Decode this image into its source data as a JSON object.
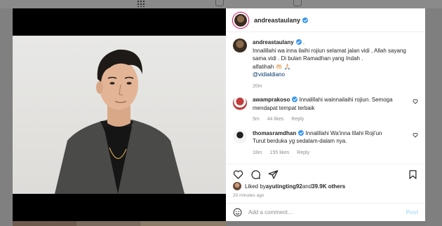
{
  "post": {
    "author": "andreastaulany",
    "menu_icon": "more-horizontal-icon"
  },
  "caption": {
    "username": "andreastaulany",
    "suffix": " .",
    "lines": [
      "Innalillahi wa inna ilaihi rojiun selamat jalan vidi , Allah sayang",
      "sama vidi . Di bulan Ramadhan yang Indah .",
      "alfatihah 🤲🏻 🙏🏻"
    ],
    "mention": "@vidialdiano",
    "time": "20m"
  },
  "comments": [
    {
      "username": "awamprakoso",
      "text_line1": " Innalillahi wainnailaihi rojiun. Semoga",
      "text_line2": "mendapat tempat terbaik",
      "time": "5m",
      "likes": "44 likes",
      "reply": "Reply"
    },
    {
      "username": "thomasramdhan",
      "text_line1": " Innalillahi Wa'inna Illahi Roji'un",
      "text_line2": "Turut berduka yg sedalam-dalam nya.",
      "time": "18m",
      "likes": "155 likes",
      "reply": "Reply"
    }
  ],
  "likes": {
    "prefix": "Liked by ",
    "user": "ayutingting92",
    "middle": " and ",
    "count": "39.9K others"
  },
  "posted_ago": "20 minutes ago",
  "add_comment": {
    "placeholder": "Add a comment…",
    "post_label": "Post"
  },
  "colors": {
    "verified": "#3897f0",
    "mention": "#00376b",
    "post_disabled": "#b2dffc"
  }
}
